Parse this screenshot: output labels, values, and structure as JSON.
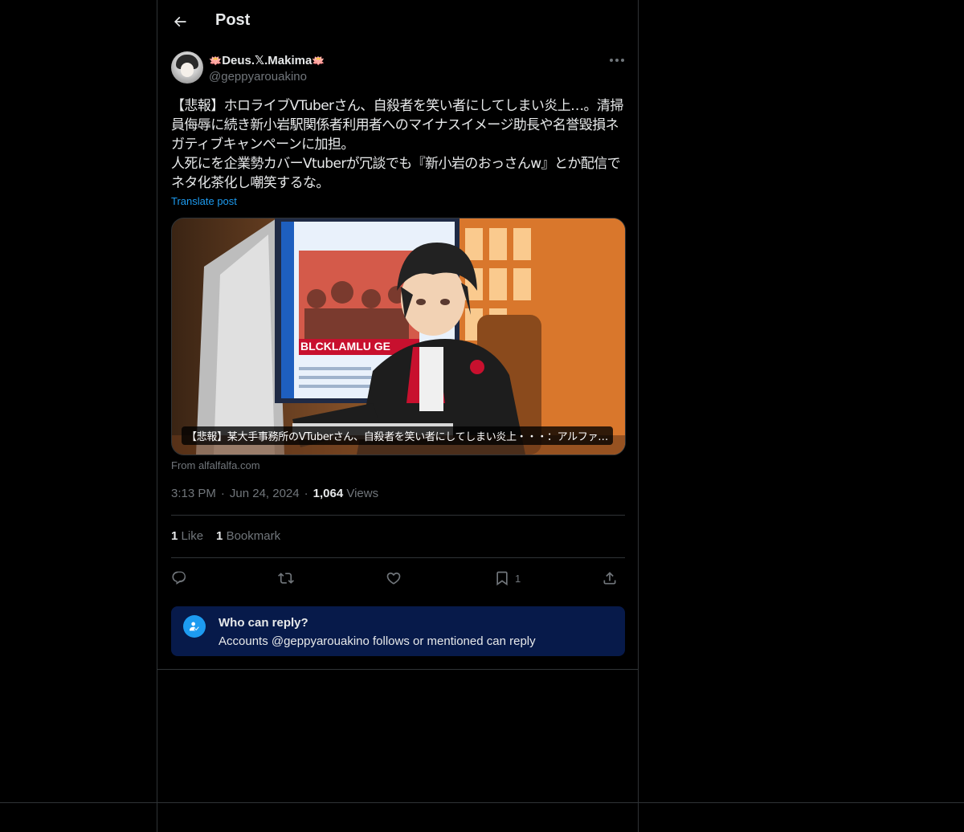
{
  "header": {
    "title": "Post"
  },
  "author": {
    "display_name_prefix": "🪷",
    "display_name": "Deus.𝕏.Makima",
    "display_name_suffix": "🪷",
    "handle": "@geppyarouakino"
  },
  "post": {
    "text": "【悲報】ホロライブVTuberさん、自殺者を笑い者にしてしまい炎上…。清掃員侮辱に続き新小岩駅関係者利用者へのマイナスイメージ助長や名誉毀損ネガティブキャンペーンに加担。\n人死にを企業勢カバーVtuberが冗談でも『新小岩のおっさんw』とか配信でネタ化茶化し嘲笑するな。",
    "translate_label": "Translate post",
    "media_caption": "【悲報】某大手事務所のVTuberさん、自殺者を笑い者にしてしまい炎上・・・：アルファ…",
    "media_source": "From alfalfalfa.com",
    "media_banner_text": "BLCKLAMLU GE",
    "time": "3:13 PM",
    "date": "Jun 24, 2024",
    "views_count": "1,064",
    "views_label": "Views"
  },
  "stats": {
    "likes_count": "1",
    "likes_label": "Like",
    "bookmarks_count": "1",
    "bookmarks_label": "Bookmark"
  },
  "actions": {
    "bookmark_count": "1",
    "icons": [
      "reply-icon",
      "repost-icon",
      "like-icon",
      "bookmark-icon",
      "share-icon"
    ]
  },
  "reply_restriction": {
    "title": "Who can reply?",
    "subtitle": "Accounts @geppyarouakino follows or mentioned can reply"
  },
  "colors": {
    "background": "#000000",
    "accent": "#1d9bf0",
    "muted": "#71767b",
    "border": "#2f3336",
    "reply_box": "#071a4a"
  }
}
